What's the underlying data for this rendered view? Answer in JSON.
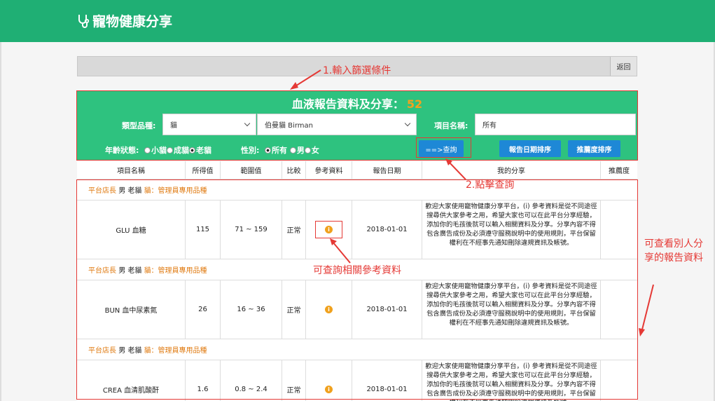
{
  "brand": {
    "title": "寵物健康分享",
    "icon": "stethoscope-icon"
  },
  "filter_bar": {
    "back_label": "返回"
  },
  "panel": {
    "title": "血液報告資料及分享：",
    "count": "52",
    "type_label": "類型品種:",
    "type_value": "貓",
    "breed_value": "伯曼貓 Birman",
    "item_label": "項目名稱:",
    "item_value": "所有",
    "age_label": "年齡狀態:",
    "age_options": [
      "小貓",
      "成貓",
      "老貓"
    ],
    "age_selected": "老貓",
    "sex_label": "性別:",
    "sex_options": [
      "所有",
      "男",
      "女"
    ],
    "sex_selected": "所有",
    "query_label": "==>查詢",
    "sort_date_label": "報告日期排序",
    "sort_rec_label": "推薦度排序"
  },
  "table": {
    "headers": [
      "項目名稱",
      "所得值",
      "範圍值",
      "比較",
      "參考資料",
      "報告日期",
      "我的分享",
      "推薦度"
    ],
    "rows": [
      {
        "owner": "平台店長",
        "sex": "男",
        "age": "老貓",
        "note": "貓：管理員專用品種",
        "item": "GLU 血糖",
        "value": "115",
        "range": "71 ~ 159",
        "compare": "正常",
        "date": "2018-01-01",
        "share": "歡迎大家使用寵物健康分享平台，(i) 參考資料是從不同途徑搜尋供大家參考之用，希望大家也可以在此平台分享經驗，添加你的毛孩後就可以輸入相關資料及分享。分享內容不得包含廣告成份及必須遵守服務說明中的使用規則，平台保留權利在不經事先通知刪除違規資訊及帳號。"
      },
      {
        "owner": "平台店長",
        "sex": "男",
        "age": "老貓",
        "note": "貓：管理員專用品種",
        "item": "BUN 血中尿素氮",
        "value": "26",
        "range": "16 ~ 36",
        "compare": "正常",
        "date": "2018-01-01",
        "share": "歡迎大家使用寵物健康分享平台，(i) 參考資料是從不同途徑搜尋供大家參考之用，希望大家也可以在此平台分享經驗，添加你的毛孩後就可以輸入相關資料及分享。分享內容不得包含廣告成份及必須遵守服務說明中的使用規則，平台保留權利在不經事先通知刪除違規資訊及帳號。"
      },
      {
        "owner": "平台店長",
        "sex": "男",
        "age": "老貓",
        "note": "貓：管理員專用品種",
        "item": "CREA 血清肌酸酐",
        "value": "1.6",
        "range": "0.8 ~ 2.4",
        "compare": "正常",
        "date": "2018-01-01",
        "share": "歡迎大家使用寵物健康分享平台，(i) 參考資料是從不同途徑搜尋供大家參考之用，希望大家也可以在此平台分享經驗，添加你的毛孩後就可以輸入相關資料及分享。分享內容不得包含廣告成份及必須遵守服務說明中的使用規則，平台保留權利在不經事先通知刪除違規資訊及帳號。"
      }
    ]
  },
  "annotations": {
    "step1": "1.輸入篩選條件",
    "step2": "2.點擊查詢",
    "ref": "可查詢相關參考資料",
    "side": "可查看別人分享的報告資料"
  },
  "colors": {
    "header": "#1faf74",
    "panel": "#2ec27f",
    "button": "#1e88d6",
    "accent": "#f4a21e",
    "annotation": "#e53935"
  }
}
